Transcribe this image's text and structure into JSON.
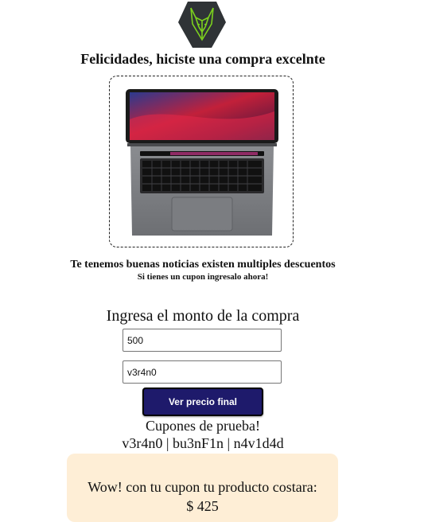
{
  "logo": {
    "icon": "wolf-logo-icon",
    "colors": {
      "background": "#2f3336",
      "lines": "#7cd11e"
    }
  },
  "header": {
    "title": "Felicidades, hiciste una compra excelnte"
  },
  "product": {
    "image_icon": "laptop-icon"
  },
  "promo": {
    "headline": "Te tenemos buenas noticias existen multiples descuentos",
    "subline": "Si tienes un cupon ingresalo ahora!"
  },
  "form": {
    "amount_label": "Ingresa el monto de la compra",
    "amount_value": "500",
    "coupon_value": "v3r4n0",
    "submit_label": "Ver precio final"
  },
  "coupons": {
    "title": "Cupones de prueba!",
    "list": "v3r4n0 | bu3nF1n | n4v1d4d"
  },
  "result": {
    "message": "Wow! con tu cupon tu producto costara:",
    "price": "$ 425",
    "background": "#feeed6"
  },
  "colors": {
    "button": "#1e1a6b"
  }
}
